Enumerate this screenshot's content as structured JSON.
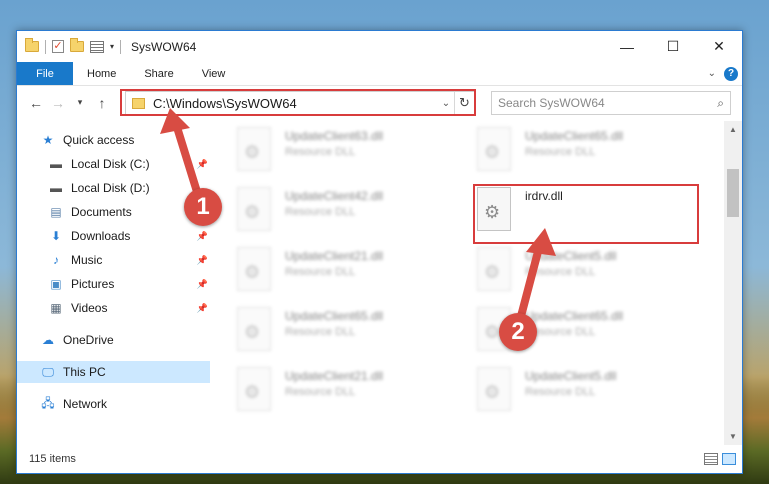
{
  "window": {
    "title": "SysWOW64",
    "buttons": {
      "minimize": "—",
      "maximize": "☐",
      "close": "✕"
    }
  },
  "ribbon": {
    "tabs": [
      "File",
      "Home",
      "Share",
      "View"
    ],
    "help": "?"
  },
  "navigation": {
    "address": "C:\\Windows\\SysWOW64",
    "search_placeholder": "Search SysWOW64"
  },
  "sidebar": {
    "items": [
      {
        "label": "Quick access",
        "icon": "star-icon"
      },
      {
        "label": "Local Disk (C:)",
        "icon": "drive-icon",
        "pinned": true
      },
      {
        "label": "Local Disk (D:)",
        "icon": "drive-icon"
      },
      {
        "label": "Documents",
        "icon": "documents-icon",
        "pinned": true
      },
      {
        "label": "Downloads",
        "icon": "download-icon",
        "pinned": true
      },
      {
        "label": "Music",
        "icon": "music-icon",
        "pinned": true
      },
      {
        "label": "Pictures",
        "icon": "pictures-icon",
        "pinned": true
      },
      {
        "label": "Videos",
        "icon": "videos-icon",
        "pinned": true
      },
      {
        "label": "OneDrive",
        "icon": "cloud-icon"
      },
      {
        "label": "This PC",
        "icon": "computer-icon",
        "selected": true
      },
      {
        "label": "Network",
        "icon": "network-icon"
      }
    ]
  },
  "files": {
    "left_column": [
      {
        "name": "UpdateClient63.dll",
        "type": "Resource DLL"
      },
      {
        "name": "UpdateClient42.dll",
        "type": "Resource DLL"
      },
      {
        "name": "UpdateClient21.dll",
        "type": "Resource DLL"
      },
      {
        "name": "UpdateClient65.dll",
        "type": "Resource DLL"
      },
      {
        "name": "UpdateClient21.dll",
        "type": "Resource DLL"
      }
    ],
    "right_column": [
      {
        "name": "UpdateClient65.dll",
        "type": "Resource DLL"
      },
      {
        "name": "irdrv.dll",
        "type": ""
      },
      {
        "name": "UpdateClient5.dll",
        "type": "Resource DLL"
      },
      {
        "name": "UpdateClient65.dll",
        "type": "Resource DLL"
      },
      {
        "name": "UpdateClient5.dll",
        "type": "Resource DLL"
      }
    ]
  },
  "status": {
    "item_count": "115 items"
  },
  "annotations": {
    "callout_1": "1",
    "callout_2": "2",
    "accent_color": "#d84c43"
  }
}
